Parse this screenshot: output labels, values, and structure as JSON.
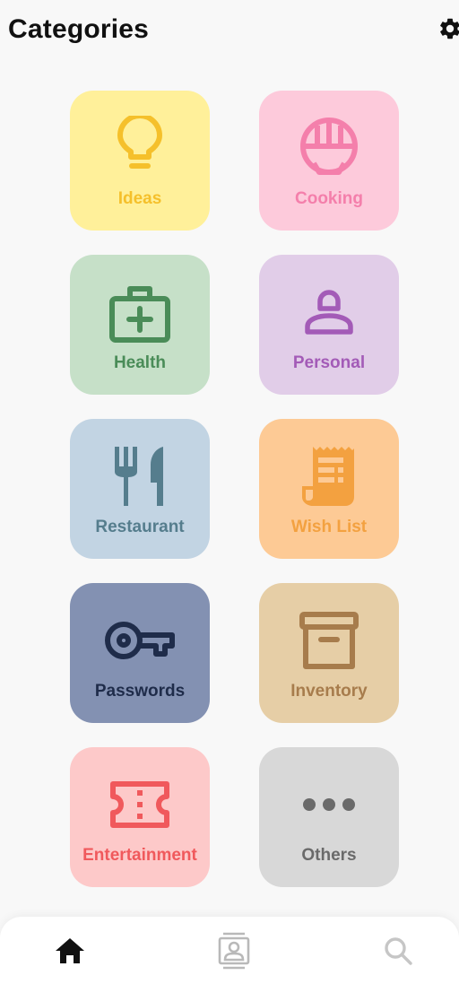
{
  "header": {
    "title": "Categories",
    "settings_icon": "gear-icon"
  },
  "categories": [
    {
      "label": "Ideas",
      "icon": "lightbulb-icon",
      "bg": "#fff09a",
      "fg": "#f5c02b"
    },
    {
      "label": "Cooking",
      "icon": "rice-bowl-icon",
      "bg": "#fdcadb",
      "fg": "#f47fab"
    },
    {
      "label": "Health",
      "icon": "medical-kit-icon",
      "bg": "#c6e0c8",
      "fg": "#4a8c58"
    },
    {
      "label": "Personal",
      "icon": "person-icon",
      "bg": "#e1cde8",
      "fg": "#a35bb7"
    },
    {
      "label": "Restaurant",
      "icon": "fork-knife-icon",
      "bg": "#c2d4e3",
      "fg": "#557d8d"
    },
    {
      "label": "Wish List",
      "icon": "receipt-icon",
      "bg": "#fdca95",
      "fg": "#f3a140"
    },
    {
      "label": "Passwords",
      "icon": "key-icon",
      "bg": "#8391b2",
      "fg": "#1f2c4a"
    },
    {
      "label": "Inventory",
      "icon": "archive-box-icon",
      "bg": "#e6cea6",
      "fg": "#a77c4c"
    },
    {
      "label": "Entertainment",
      "icon": "ticket-icon",
      "bg": "#fdc9c9",
      "fg": "#f0595c"
    },
    {
      "label": "Others",
      "icon": "more-dots-icon",
      "bg": "#d8d8d8",
      "fg": "#6a6a6a"
    }
  ],
  "bottom_nav": [
    {
      "name": "home",
      "icon": "home-icon",
      "color": "#111111",
      "active": true
    },
    {
      "name": "contacts",
      "icon": "contact-card-icon",
      "color": "#b9b9b9",
      "active": false
    },
    {
      "name": "search",
      "icon": "search-icon",
      "color": "#c6c6c6",
      "active": false
    }
  ]
}
